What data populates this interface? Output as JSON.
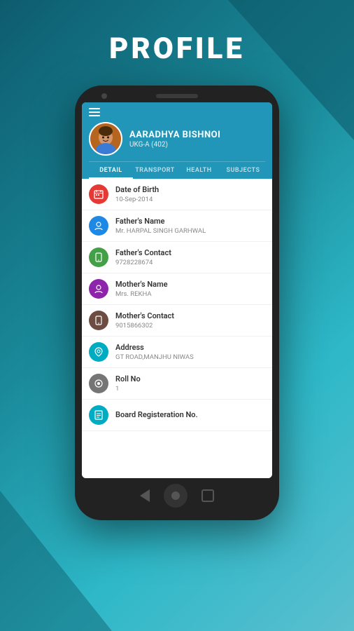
{
  "page": {
    "title": "PROFILE",
    "background_colors": {
      "primary": "#0d5c6e",
      "secondary": "#2eb8c8",
      "accent": "#2196b8"
    }
  },
  "phone": {
    "header": {
      "student_name": "AARADHYA BISHNOI",
      "student_class": "UKG-A (402)"
    },
    "tabs": [
      {
        "id": "detail",
        "label": "DETAIL",
        "active": true
      },
      {
        "id": "transport",
        "label": "TRANSPORT",
        "active": false
      },
      {
        "id": "health",
        "label": "HEALTH",
        "active": false
      },
      {
        "id": "subjects",
        "label": "SUBJECTS",
        "active": false
      }
    ],
    "list_items": [
      {
        "id": "dob",
        "icon_color": "#e53935",
        "icon_symbol": "📅",
        "label": "Date of Birth",
        "value": "10-Sep-2014"
      },
      {
        "id": "father-name",
        "icon_color": "#1e88e5",
        "icon_symbol": "👤",
        "label": "Father's Name",
        "value": "Mr. HARPAL SINGH GARHWAL"
      },
      {
        "id": "father-contact",
        "icon_color": "#43a047",
        "icon_symbol": "📱",
        "label": "Father's Contact",
        "value": "9728228674"
      },
      {
        "id": "mother-name",
        "icon_color": "#8e24aa",
        "icon_symbol": "👤",
        "label": "Mother's Name",
        "value": "Mrs. REKHA"
      },
      {
        "id": "mother-contact",
        "icon_color": "#6d4c41",
        "icon_symbol": "📱",
        "label": "Mother's Contact",
        "value": "9015866302"
      },
      {
        "id": "address",
        "icon_color": "#00acc1",
        "icon_symbol": "🏠",
        "label": "Address",
        "value": "GT ROAD,MANJHU NIWAS"
      },
      {
        "id": "roll-no",
        "icon_color": "#757575",
        "icon_symbol": "⚙",
        "label": "Roll No",
        "value": "1"
      },
      {
        "id": "board-reg",
        "icon_color": "#00acc1",
        "icon_symbol": "📋",
        "label": "Board Registeration No.",
        "value": ""
      }
    ]
  }
}
